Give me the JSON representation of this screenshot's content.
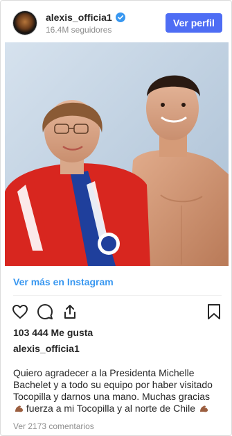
{
  "header": {
    "username": "alexis_officia1",
    "followers": "16.4M seguidores",
    "profile_button": "Ver perfil"
  },
  "post": {
    "view_more": "Ver más en Instagram",
    "likes": "103 444 Me gusta",
    "caption_user": "alexis_officia1",
    "caption_part1": "Quiero agradecer a la Presidenta Michelle Bachelet y a todo su equipo por haber visitado Tocopilla y darnos una mano. Muchas gracias",
    "caption_part2": "fuerza a mi Tocopilla y al norte de Chile",
    "comments": "Ver 2173 comentarios"
  },
  "icons": {
    "verified": "verified-badge-icon",
    "like": "heart-icon",
    "comment": "comment-icon",
    "share": "share-icon",
    "save": "bookmark-icon",
    "emoji": "flexed-biceps-icon"
  },
  "colors": {
    "primary_button": "#4e6df4",
    "link": "#3897f0",
    "text": "#262626",
    "muted": "#8e8e8e"
  }
}
